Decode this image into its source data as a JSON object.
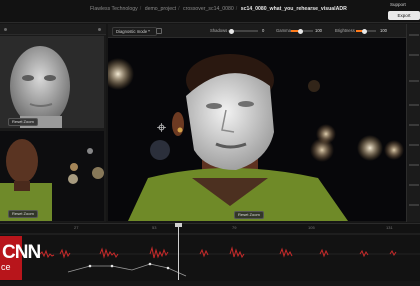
{
  "header": {
    "breadcrumbs": [
      "Flawless Technology",
      "demo_project",
      "crossover_sc14_0080",
      "sc14_0080_what_you_rehearse_visualADR"
    ],
    "support_label": "Support",
    "export_label": "Export"
  },
  "viewer_toolbar": {
    "mode_select_value": "Diagnostic mode",
    "controls": [
      {
        "label": "Shadows",
        "value": "0"
      },
      {
        "label": "Gamma",
        "value": "100"
      },
      {
        "label": "Brightness",
        "value": "100"
      }
    ]
  },
  "left_panel": {
    "top_reset_label": "Reset Zoom",
    "bottom_reset_label": "Reset Zoom"
  },
  "main_view": {
    "reset_label": "Reset Zoom"
  },
  "timeline": {
    "ticks": [
      "27",
      "53",
      "79",
      "105",
      "131"
    ]
  },
  "logo": {
    "line1": "CNN",
    "line2": "ce"
  },
  "colors": {
    "accent": "#ff7a1a",
    "waveform": "#c72a2a",
    "logo_red": "#b8151b"
  }
}
